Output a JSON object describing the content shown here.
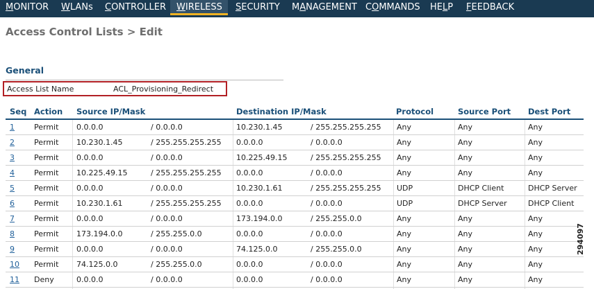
{
  "nav": [
    {
      "underline": "M",
      "rest": "ONITOR"
    },
    {
      "underline": "W",
      "rest": "LANs"
    },
    {
      "underline": "C",
      "rest": "ONTROLLER"
    },
    {
      "underline": "W",
      "rest": "IRELESS"
    },
    {
      "underline": "S",
      "rest": "ECURITY"
    },
    {
      "pre": "M",
      "underline": "A",
      "rest": "NAGEMENT"
    },
    {
      "pre": "C",
      "underline": "O",
      "rest": "MMANDS"
    },
    {
      "pre": "HE",
      "underline": "L",
      "rest": "P"
    },
    {
      "underline": "F",
      "rest": "EEDBACK"
    }
  ],
  "page": {
    "title": "Access Control Lists > Edit",
    "section": "General",
    "name_label": "Access List Name",
    "name_value": "ACL_Provisioning_Redirect"
  },
  "table": {
    "headers": [
      "Seq",
      "Action",
      "Source IP/Mask",
      "Destination IP/Mask",
      "Protocol",
      "Source Port",
      "Dest Port"
    ],
    "rows": [
      {
        "seq": "1",
        "action": "Permit",
        "src_ip": "0.0.0.0",
        "src_mask": "/ 0.0.0.0",
        "dst_ip": "10.230.1.45",
        "dst_mask": "/ 255.255.255.255",
        "protocol": "Any",
        "src_port": "Any",
        "dst_port": "Any"
      },
      {
        "seq": "2",
        "action": "Permit",
        "src_ip": "10.230.1.45",
        "src_mask": "/ 255.255.255.255",
        "dst_ip": "0.0.0.0",
        "dst_mask": "/ 0.0.0.0",
        "protocol": "Any",
        "src_port": "Any",
        "dst_port": "Any"
      },
      {
        "seq": "3",
        "action": "Permit",
        "src_ip": "0.0.0.0",
        "src_mask": "/ 0.0.0.0",
        "dst_ip": "10.225.49.15",
        "dst_mask": "/ 255.255.255.255",
        "protocol": "Any",
        "src_port": "Any",
        "dst_port": "Any"
      },
      {
        "seq": "4",
        "action": "Permit",
        "src_ip": "10.225.49.15",
        "src_mask": "/ 255.255.255.255",
        "dst_ip": "0.0.0.0",
        "dst_mask": "/ 0.0.0.0",
        "protocol": "Any",
        "src_port": "Any",
        "dst_port": "Any"
      },
      {
        "seq": "5",
        "action": "Permit",
        "src_ip": "0.0.0.0",
        "src_mask": "/ 0.0.0.0",
        "dst_ip": "10.230.1.61",
        "dst_mask": "/ 255.255.255.255",
        "protocol": "UDP",
        "src_port": "DHCP Client",
        "dst_port": "DHCP Server"
      },
      {
        "seq": "6",
        "action": "Permit",
        "src_ip": "10.230.1.61",
        "src_mask": "/ 255.255.255.255",
        "dst_ip": "0.0.0.0",
        "dst_mask": "/ 0.0.0.0",
        "protocol": "UDP",
        "src_port": "DHCP Server",
        "dst_port": "DHCP Client"
      },
      {
        "seq": "7",
        "action": "Permit",
        "src_ip": "0.0.0.0",
        "src_mask": "/ 0.0.0.0",
        "dst_ip": "173.194.0.0",
        "dst_mask": "/ 255.255.0.0",
        "protocol": "Any",
        "src_port": "Any",
        "dst_port": "Any"
      },
      {
        "seq": "8",
        "action": "Permit",
        "src_ip": "173.194.0.0",
        "src_mask": "/ 255.255.0.0",
        "dst_ip": "0.0.0.0",
        "dst_mask": "/ 0.0.0.0",
        "protocol": "Any",
        "src_port": "Any",
        "dst_port": "Any"
      },
      {
        "seq": "9",
        "action": "Permit",
        "src_ip": "0.0.0.0",
        "src_mask": "/ 0.0.0.0",
        "dst_ip": "74.125.0.0",
        "dst_mask": "/ 255.255.0.0",
        "protocol": "Any",
        "src_port": "Any",
        "dst_port": "Any"
      },
      {
        "seq": "10",
        "action": "Permit",
        "src_ip": "74.125.0.0",
        "src_mask": "/ 255.255.0.0",
        "dst_ip": "0.0.0.0",
        "dst_mask": "/ 0.0.0.0",
        "protocol": "Any",
        "src_port": "Any",
        "dst_port": "Any"
      },
      {
        "seq": "11",
        "action": "Deny",
        "src_ip": "0.0.0.0",
        "src_mask": "/ 0.0.0.0",
        "dst_ip": "0.0.0.0",
        "dst_mask": "/ 0.0.0.0",
        "protocol": "Any",
        "src_port": "Any",
        "dst_port": "Any"
      }
    ]
  },
  "figure_id": "294097",
  "colors": {
    "nav_bg": "#1a3a52",
    "nav_active_underline": "#f0b323",
    "header_text": "#1a4f78",
    "highlight_box": "#b21f24",
    "link": "#1f5f99"
  }
}
